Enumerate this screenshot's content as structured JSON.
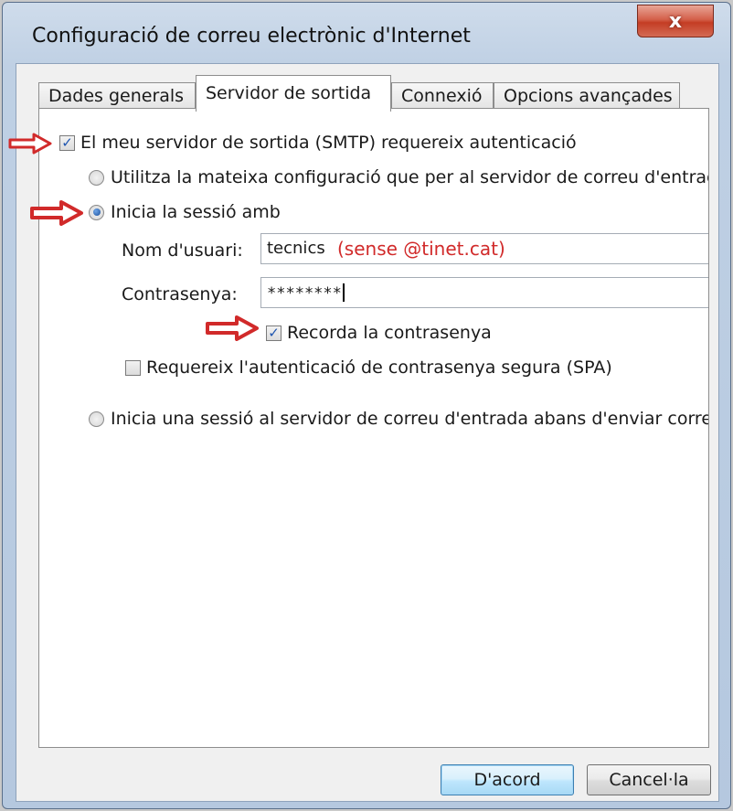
{
  "window": {
    "title": "Configuració de correu electrònic d'Internet",
    "close_label": "x"
  },
  "tabs": [
    {
      "label": "Dades generals",
      "active": false
    },
    {
      "label": "Servidor de sortida",
      "active": true
    },
    {
      "label": "Connexió",
      "active": false
    },
    {
      "label": "Opcions avançades",
      "active": false
    }
  ],
  "outgoing": {
    "smtp_auth_label": "El meu servidor de sortida (SMTP) requereix autenticació",
    "smtp_auth_checked": true,
    "same_settings_label": "Utilitza la mateixa configuració que per al servidor de correu d'entrac",
    "same_settings_selected": false,
    "login_with_label": "Inicia la sessió amb",
    "login_with_selected": true,
    "username_label": "Nom d'usuari:",
    "username_value": "tecnics",
    "username_note": "(sense @tinet.cat)",
    "password_label": "Contrasenya:",
    "password_value": "********",
    "remember_label": "Recorda la contrasenya",
    "remember_checked": true,
    "spa_label": "Requereix l'autenticació de contrasenya segura (SPA)",
    "spa_checked": false,
    "login_incoming_label": "Inicia una sessió al servidor de correu d'entrada abans d'enviar corre",
    "login_incoming_selected": false
  },
  "buttons": {
    "ok_label": "D'acord",
    "cancel_label": "Cancel·la"
  },
  "colors": {
    "annotation_red": "#d12a2a",
    "check_blue": "#1f56b0"
  },
  "icons": {
    "close": "close-icon",
    "check": "checkmark-icon",
    "annotation_arrow": "arrow-right-icon"
  }
}
